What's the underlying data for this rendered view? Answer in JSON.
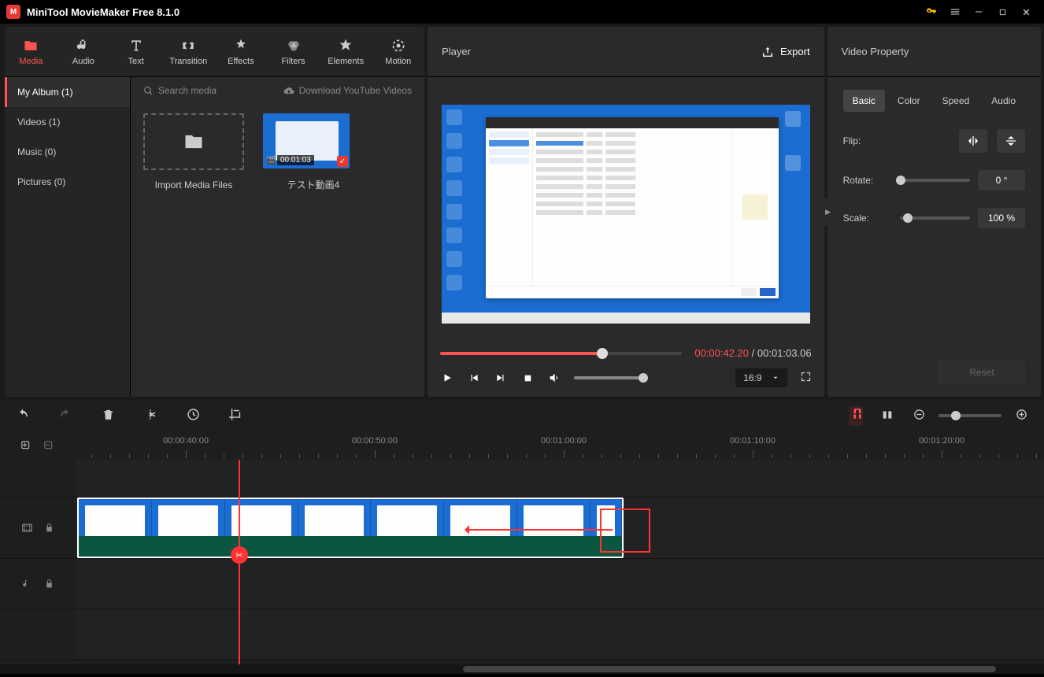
{
  "app": {
    "title": "MiniTool MovieMaker Free 8.1.0"
  },
  "nav": {
    "media": "Media",
    "audio": "Audio",
    "text": "Text",
    "transition": "Transition",
    "effects": "Effects",
    "filters": "Filters",
    "elements": "Elements",
    "motion": "Motion"
  },
  "sidebar": {
    "items": [
      {
        "label": "My Album (1)"
      },
      {
        "label": "Videos (1)"
      },
      {
        "label": "Music (0)"
      },
      {
        "label": "Pictures (0)"
      }
    ]
  },
  "search": {
    "placeholder": "Search media",
    "download_label": "Download YouTube Videos"
  },
  "media": {
    "import_label": "Import Media Files",
    "clip": {
      "label": "テスト動画4",
      "duration": "00:01:03"
    }
  },
  "player": {
    "title": "Player",
    "export": "Export",
    "current_time": "00:00:42.20",
    "sep": " / ",
    "total_time": "00:01:03.06",
    "ratio": "16:9"
  },
  "props": {
    "title": "Video Property",
    "tabs": {
      "basic": "Basic",
      "color": "Color",
      "speed": "Speed",
      "audio": "Audio"
    },
    "flip_label": "Flip:",
    "rotate_label": "Rotate:",
    "rotate_value": "0 °",
    "scale_label": "Scale:",
    "scale_value": "100 %",
    "reset": "Reset"
  },
  "timeline": {
    "labels": [
      "00:00:40:00",
      "00:00:50:00",
      "00:01:00:00",
      "00:01:10:00",
      "00:01:20:00"
    ]
  }
}
